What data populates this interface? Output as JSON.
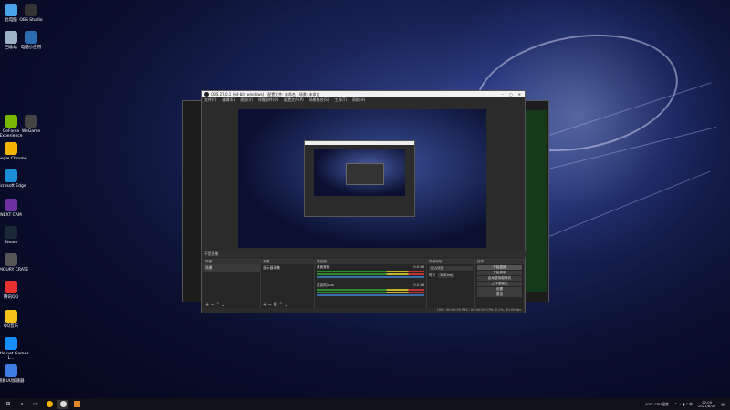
{
  "desktop": {
    "icons": [
      {
        "label": "此电脑",
        "color": "#4aa3e8"
      },
      {
        "label": "OBS Studio",
        "color": "#333333"
      },
      {
        "label": "回收站",
        "color": "#9fb3c8"
      },
      {
        "label": "电脑小应用",
        "color": "#2b6cb0"
      },
      {
        "label": "GeForce Experience",
        "color": "#76b900"
      },
      {
        "label": "WeGame",
        "color": "#444444"
      },
      {
        "label": "Google Chrome",
        "color": "#f4b400"
      },
      {
        "label": "Microsoft Edge",
        "color": "#1a8fd6"
      },
      {
        "label": "NEXT CAM",
        "color": "#6b2fa0"
      },
      {
        "label": "Steam",
        "color": "#1b2838"
      },
      {
        "label": "ARMOURY CRATE",
        "color": "#555555"
      },
      {
        "label": "腾讯QQ",
        "color": "#e8312f"
      },
      {
        "label": "QQ音乐",
        "color": "#f7c21a"
      },
      {
        "label": "Battle.net Games L...",
        "color": "#148eff"
      },
      {
        "label": "网易UU加速器",
        "color": "#3b7de0"
      }
    ]
  },
  "obs": {
    "title": "OBS 27.0.1 (64-bit, windows) - 配置文件: 未命名 - 场景: 未命名",
    "menu": [
      "文件(F)",
      "编辑(E)",
      "视图(V)",
      "停靠部件(D)",
      "配置文件(P)",
      "场景集合(S)",
      "工具(T)",
      "帮助(H)"
    ],
    "preview_label": "不是直播",
    "docks": {
      "scenes": {
        "title": "场景",
        "items": [
          "场景"
        ]
      },
      "sources": {
        "title": "来源",
        "items": [
          "显示器采集"
        ]
      },
      "mixer": {
        "title": "混音器",
        "channels": [
          {
            "name": "桌面音频",
            "db": "0.0 dB"
          },
          {
            "name": "麦克风/Aux",
            "db": "0.0 dB"
          }
        ]
      },
      "transitions": {
        "title": "场景转场",
        "type": "淡入淡出",
        "duration_label": "时长",
        "duration": "300 ms"
      },
      "controls": {
        "title": "控件",
        "buttons": [
          "开始直播",
          "开始录制",
          "启动虚拟摄像机",
          "工作室模式",
          "设置",
          "退出"
        ]
      }
    },
    "status": "LIVE: 00:00:00   REC: 00:00:00   CPU: 2.1%, 30.00 fps"
  },
  "taskbar": {
    "weather": "40°C CPU温度",
    "time": "22:05",
    "date": "2021/6/22"
  }
}
